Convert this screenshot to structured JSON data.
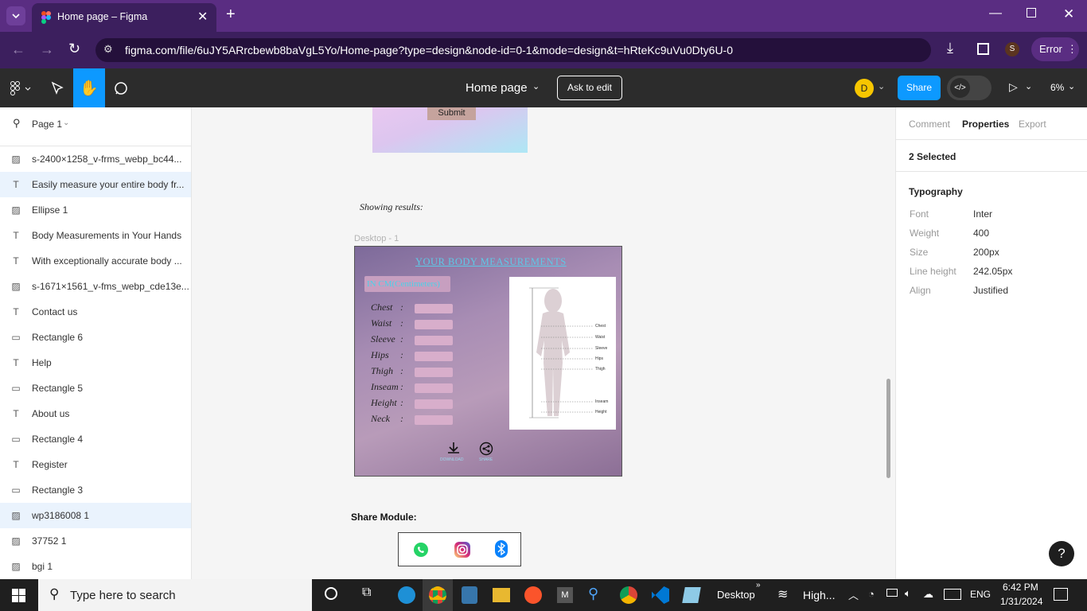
{
  "browser": {
    "tab_title": "Home page – Figma",
    "url": "figma.com/file/6uJY5ARrcbewb8baVgL5Yo/Home-page?type=design&node-id=0-1&mode=design&t=hRteKc9uVu0Dty6U-0",
    "profile_initial": "S",
    "error_label": "Error"
  },
  "figma": {
    "file_name": "Home page",
    "ask_to_edit": "Ask to edit",
    "user_initial": "D",
    "share_label": "Share",
    "zoom": "6%",
    "page_label": "Page 1"
  },
  "layers": [
    {
      "icon": "image",
      "label": "s-2400×1258_v-frms_webp_bc44...",
      "selected": false
    },
    {
      "icon": "text",
      "label": "Easily measure your entire body fr...",
      "selected": true
    },
    {
      "icon": "image",
      "label": "Ellipse 1",
      "selected": false
    },
    {
      "icon": "text",
      "label": "Body Measurements in Your Hands",
      "selected": false
    },
    {
      "icon": "text",
      "label": "With exceptionally accurate body ...",
      "selected": false
    },
    {
      "icon": "image",
      "label": "s-1671×1561_v-fms_webp_cde13e...",
      "selected": false
    },
    {
      "icon": "text",
      "label": "Contact us",
      "selected": false
    },
    {
      "icon": "rect",
      "label": "Rectangle 6",
      "selected": false
    },
    {
      "icon": "text",
      "label": "Help",
      "selected": false
    },
    {
      "icon": "rect",
      "label": "Rectangle 5",
      "selected": false
    },
    {
      "icon": "text",
      "label": "About us",
      "selected": false
    },
    {
      "icon": "rect",
      "label": "Rectangle 4",
      "selected": false
    },
    {
      "icon": "text",
      "label": "Register",
      "selected": false
    },
    {
      "icon": "rect",
      "label": "Rectangle 3",
      "selected": false
    },
    {
      "icon": "image",
      "label": "wp3186008 1",
      "selected": true
    },
    {
      "icon": "image",
      "label": "37752 1",
      "selected": false
    },
    {
      "icon": "image",
      "label": "bgi 1",
      "selected": false
    }
  ],
  "right_panel": {
    "tabs": [
      "Comment",
      "Properties",
      "Export"
    ],
    "selection": "2 Selected",
    "section": "Typography",
    "props": [
      {
        "k": "Font",
        "v": "Inter"
      },
      {
        "k": "Weight",
        "v": "400"
      },
      {
        "k": "Size",
        "v": "200px"
      },
      {
        "k": "Line height",
        "v": "242.05px"
      },
      {
        "k": "Align",
        "v": "Justified"
      }
    ]
  },
  "canvas": {
    "submit_label": "Submit",
    "showing_results": "Showing results:",
    "frame_label": "Desktop - 1",
    "design_title": "YOUR BODY MEASUREMENTS",
    "unit_badge": "IN CM(Centimeters)",
    "measurements": [
      "Chest",
      "Waist",
      "Sleeve",
      "Hips",
      "Thigh",
      "Inseam",
      "Height",
      "Neck"
    ],
    "figure_labels": [
      "Chest",
      "Waist",
      "Sleeve",
      "Hips",
      "Thigh",
      "Inseam",
      "Height"
    ],
    "download_label": "DOWNLOAD",
    "share_small_label": "SHARE",
    "share_module_label": "Share Module:"
  },
  "taskbar": {
    "search_placeholder": "Type here to search",
    "desktop_label": "Desktop",
    "weather_label": "High...",
    "lang": "ENG",
    "time": "6:42 PM",
    "date": "1/31/2024"
  },
  "colors": {
    "chrome_purple": "#5a2d82",
    "figma_blue": "#0d99ff",
    "selection_bg": "#eaf3fd"
  }
}
